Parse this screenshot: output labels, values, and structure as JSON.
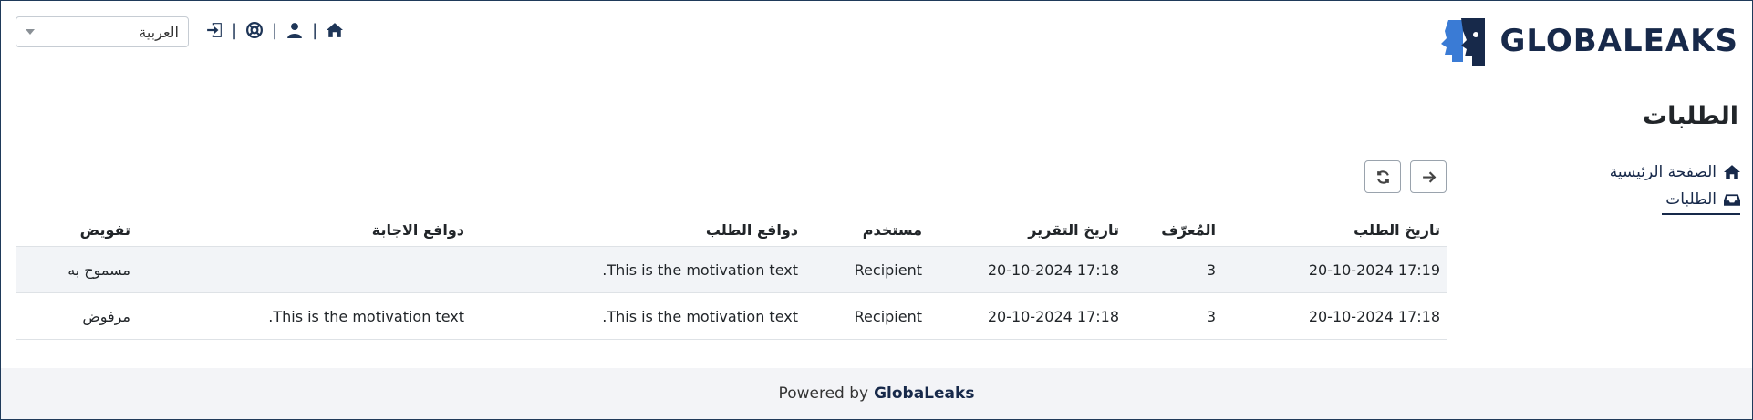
{
  "header": {
    "logo_text": "GLOBALEAKS",
    "language": "العربية",
    "sep": "|"
  },
  "sidebar": {
    "page_title": "الطلبات",
    "items": [
      {
        "label": "الصفحة الرئيسية",
        "icon": "home-icon"
      },
      {
        "label": "الطلبات",
        "icon": "inbox-icon"
      }
    ]
  },
  "table": {
    "headers": [
      "تاريخ الطلب",
      "المُعرّف",
      "تاريخ التقرير",
      "مستخدم",
      "دوافع الطلب",
      "دوافع الاجابة",
      "تفويض"
    ],
    "rows": [
      [
        "20-10-2024 17:19",
        "3",
        "20-10-2024 17:18",
        "Recipient",
        "This is the motivation text.",
        "",
        "مسموح به"
      ],
      [
        "20-10-2024 17:18",
        "3",
        "20-10-2024 17:18",
        "Recipient",
        "This is the motivation text.",
        "This is the motivation text.",
        "مرفوض"
      ]
    ]
  },
  "footer": {
    "powered_by": "Powered by",
    "brand": "GlobaLeaks"
  },
  "colors": {
    "brand": "#17294a",
    "logo_blue": "#3a7bd5",
    "footer_bg": "#f3f4f7",
    "row_stripe": "#f2f4f7"
  }
}
